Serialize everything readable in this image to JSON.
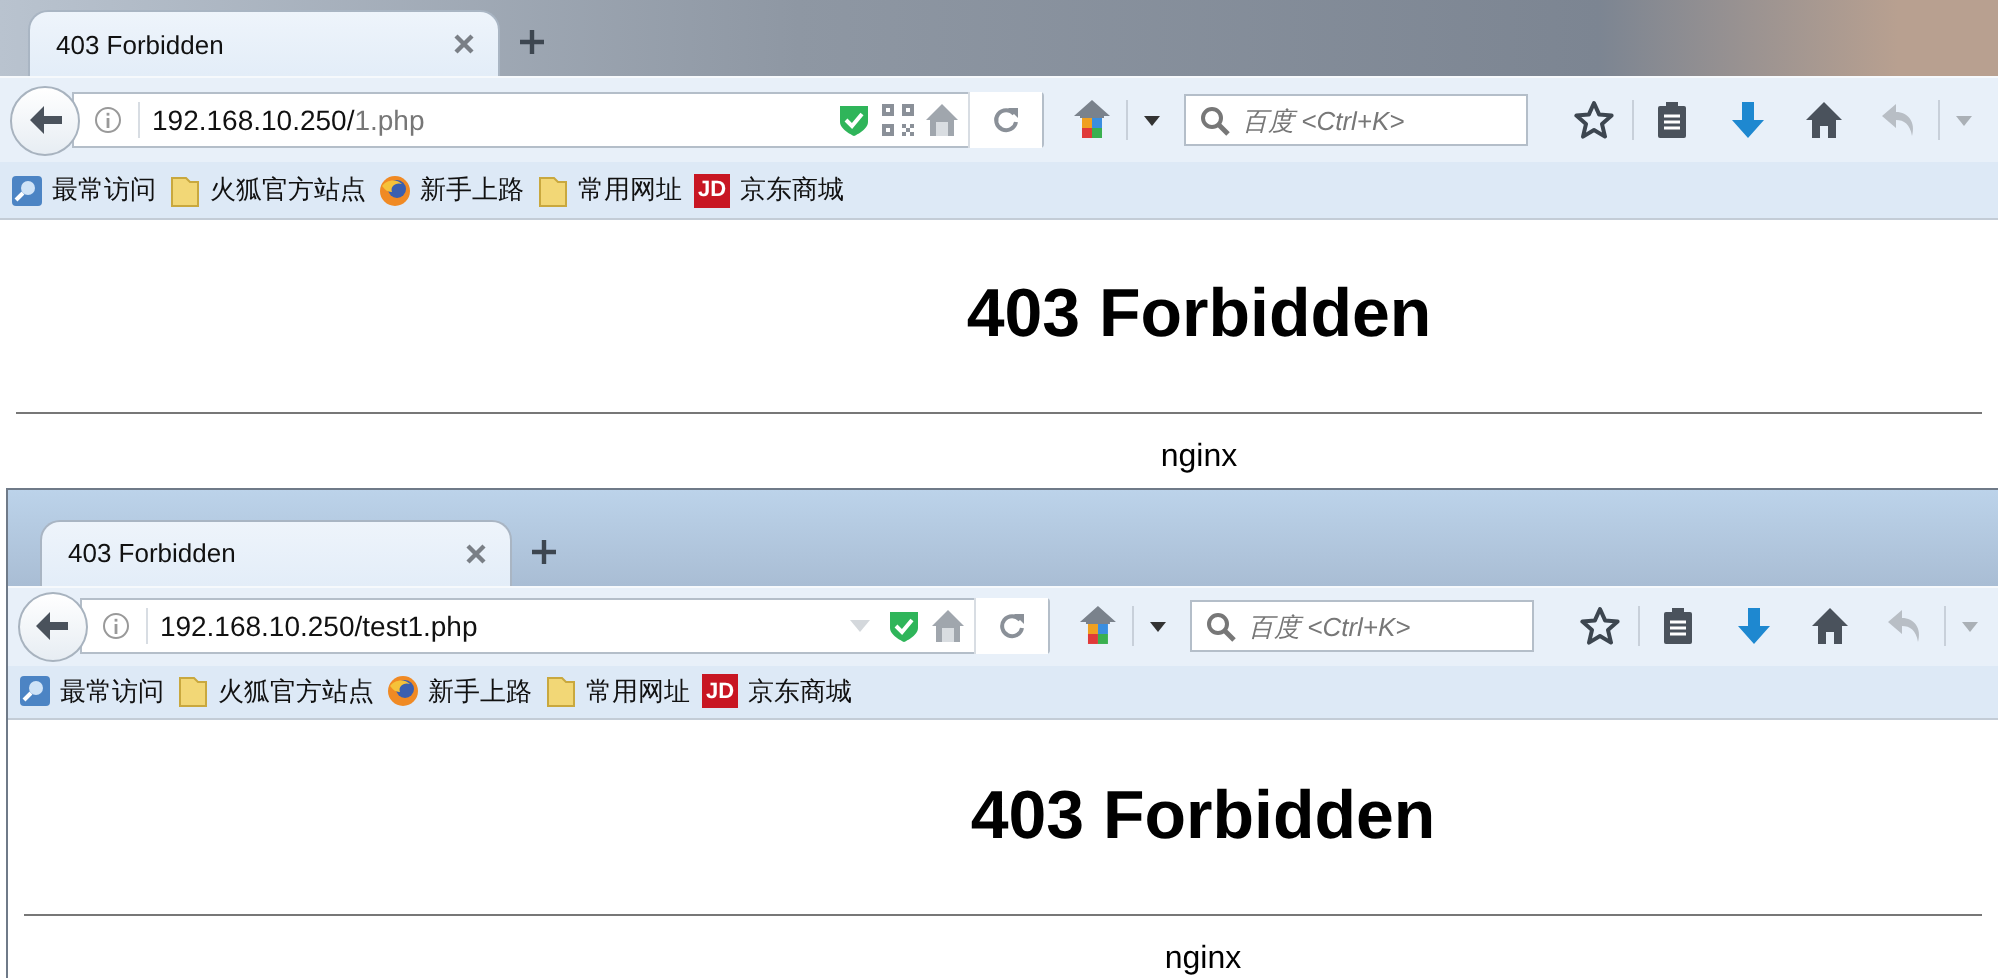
{
  "windows": [
    {
      "tabs": [
        {
          "title": "403 Forbidden",
          "selected": true
        }
      ],
      "url": {
        "host": "192.168.10.250/",
        "path": "1.php",
        "path_dimmed": true
      },
      "url_icons": [
        {
          "kind": "shield"
        },
        {
          "kind": "qr"
        },
        {
          "kind": "home"
        }
      ],
      "search": {
        "placeholder": "百度 <Ctrl+K>"
      },
      "bookmarks": [
        {
          "kind": "visited",
          "label": "最常访问"
        },
        {
          "kind": "folder",
          "label": "火狐官方站点"
        },
        {
          "kind": "firefox",
          "label": "新手上路"
        },
        {
          "kind": "folder",
          "label": "常用网址"
        },
        {
          "kind": "jd",
          "icon_text": "JD",
          "label": "京东商城"
        }
      ],
      "page": {
        "heading": "403 Forbidden",
        "footer": "nginx"
      }
    },
    {
      "tabs": [
        {
          "title": "403 Forbidden",
          "selected": true
        }
      ],
      "url": {
        "host": "192.168.10.250/",
        "path": "test1.php",
        "path_dimmed": false
      },
      "url_icons": [
        {
          "kind": "dropmarker"
        },
        {
          "kind": "shield"
        },
        {
          "kind": "home"
        }
      ],
      "search": {
        "placeholder": "百度 <Ctrl+K>"
      },
      "bookmarks": [
        {
          "kind": "visited",
          "label": "最常访问"
        },
        {
          "kind": "folder",
          "label": "火狐官方站点"
        },
        {
          "kind": "firefox",
          "label": "新手上路"
        },
        {
          "kind": "folder",
          "label": "常用网址"
        },
        {
          "kind": "jd",
          "icon_text": "JD",
          "label": "京东商城"
        }
      ],
      "page": {
        "heading": "403 Forbidden",
        "footer": "nginx"
      }
    }
  ]
}
